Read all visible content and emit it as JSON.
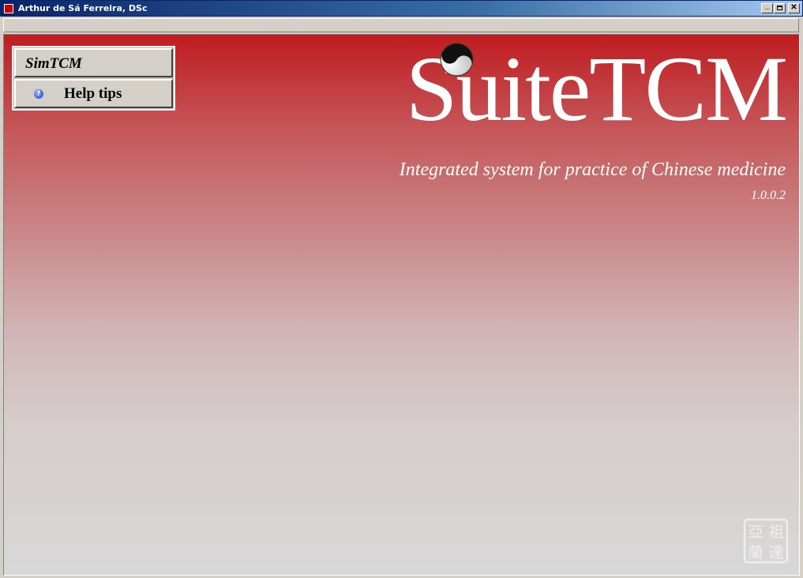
{
  "window": {
    "title": "Arthur de Sá Ferreira, DSc",
    "controls": [
      "minimize-icon",
      "maximize-icon",
      "close-icon"
    ]
  },
  "panel": {
    "sim_label": "SimTCM",
    "help_label": "Help tips",
    "help_icon": "help-icon"
  },
  "brand": {
    "logo_text": "SuiteTCM",
    "tagline": "Integrated system for practice of Chinese medicine",
    "version": "1.0.0.2"
  },
  "colors": {
    "gradient_top": "#bf1c20",
    "gradient_bottom": "#d8d8d8",
    "titlebar": "#0a246a"
  },
  "seal": {
    "characters": "亞祖 蘭達"
  }
}
